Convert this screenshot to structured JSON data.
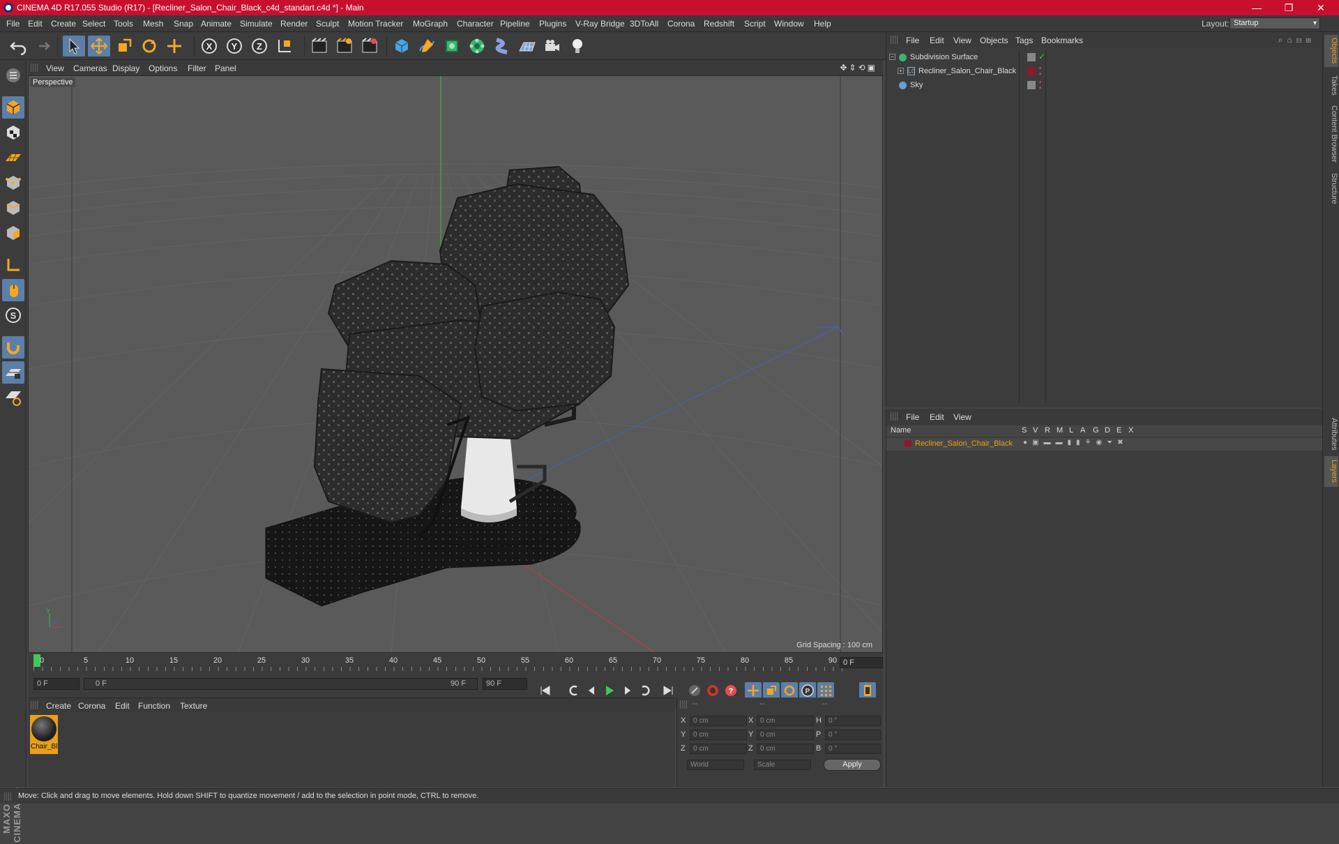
{
  "window": {
    "title": "CINEMA 4D R17.055 Studio (R17) - [Recliner_Salon_Chair_Black_c4d_standart.c4d *] - Main",
    "minimize": "—",
    "maximize": "❐",
    "close": "✕"
  },
  "menubar": {
    "items": [
      "File",
      "Edit",
      "Create",
      "Select",
      "Tools",
      "Mesh",
      "Snap",
      "Animate",
      "Simulate",
      "Render",
      "Sculpt",
      "Motion Tracker",
      "MoGraph",
      "Character",
      "Pipeline",
      "Plugins",
      "V-Ray Bridge",
      "3DToAll",
      "Corona",
      "Redshift",
      "Script",
      "Window",
      "Help"
    ],
    "layout_label": "Layout:",
    "layout_value": "Startup"
  },
  "toolbar": {
    "axis_x": "X",
    "axis_y": "Y",
    "axis_z": "Z",
    "accent": "#5b7fa8"
  },
  "viewport": {
    "menu": [
      "View",
      "Cameras",
      "Display",
      "Options",
      "Filter",
      "Panel"
    ],
    "label": "Perspective",
    "grid_spacing": "Grid Spacing : 100 cm"
  },
  "timeline": {
    "ticks": [
      "0",
      "5",
      "10",
      "15",
      "20",
      "25",
      "30",
      "35",
      "40",
      "45",
      "50",
      "55",
      "60",
      "65",
      "70",
      "75",
      "80",
      "85",
      "90"
    ],
    "frame_end_display": "0 F",
    "start_field": "0 F",
    "range_start": "0 F",
    "range_end": "90 F",
    "end_field": "90 F"
  },
  "material_manager": {
    "menu": [
      "Create",
      "Corona",
      "Edit",
      "Function",
      "Texture"
    ],
    "material_name": "Chair_Bl"
  },
  "coordinates": {
    "header": [
      "--",
      "--",
      "--"
    ],
    "rows": [
      {
        "label": "X",
        "pos": "0 cm",
        "label2": "X",
        "size": "0 cm",
        "label3": "H",
        "rot": "0 °"
      },
      {
        "label": "Y",
        "pos": "0 cm",
        "label2": "Y",
        "size": "0 cm",
        "label3": "P",
        "rot": "0 °"
      },
      {
        "label": "Z",
        "pos": "0 cm",
        "label2": "Z",
        "size": "0 cm",
        "label3": "B",
        "rot": "0 °"
      }
    ],
    "mode1": "World",
    "mode2": "Scale",
    "apply": "Apply"
  },
  "object_manager": {
    "menu": [
      "File",
      "Edit",
      "View",
      "Objects",
      "Tags",
      "Bookmarks"
    ],
    "objects": [
      {
        "name": "Subdivision Surface",
        "color": "#3cb371"
      },
      {
        "name": "Recliner_Salon_Chair_Black",
        "color": "#8b1a2b"
      },
      {
        "name": "Sky",
        "color": "#6a9fd4"
      }
    ]
  },
  "layer_manager": {
    "menu": [
      "File",
      "Edit",
      "View"
    ],
    "columns": [
      "Name",
      "S",
      "V",
      "R",
      "M",
      "L",
      "A",
      "G",
      "D",
      "E",
      "X"
    ],
    "layer_name": "Recliner_Salon_Chair_Black",
    "layer_color": "#e8a019"
  },
  "side_tabs": [
    "Objects",
    "Takes",
    "Content Browser",
    "Structure",
    "Attributes",
    "Layers"
  ],
  "status": "Move: Click and drag to move elements. Hold down SHIFT to quantize movement / add to the selection in point mode, CTRL to remove."
}
